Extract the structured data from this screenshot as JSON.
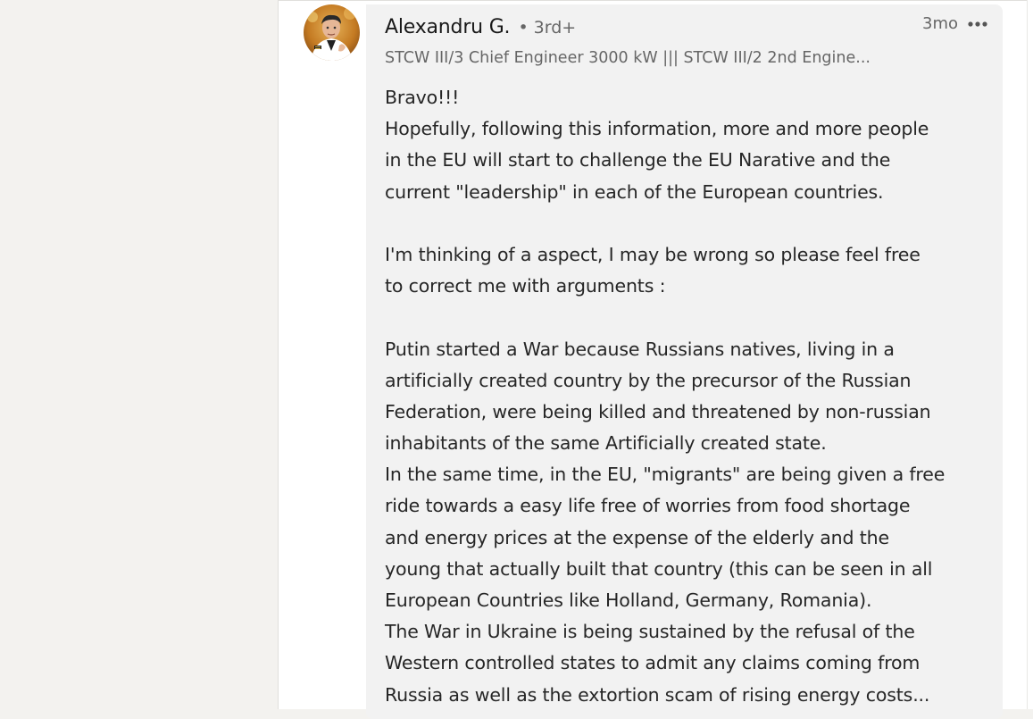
{
  "comment": {
    "author": {
      "name": "Alexandru G.",
      "degree": "• 3rd+",
      "headline": "STCW III/3 Chief Engineer 3000 kW ||| STCW III/2 2nd Engine..."
    },
    "timestamp": "3mo",
    "more_icon": "ellipsis-icon",
    "body": {
      "p1": [
        "Bravo!!!",
        "Hopefully, following this information, more and more people",
        "in the EU will start to challenge the EU Narative and the",
        "current \"leadership\" in each of the European countries."
      ],
      "p2": [
        "I'm thinking of a aspect, I may be wrong so please feel free",
        "to correct me with arguments :"
      ],
      "p3": [
        "Putin started a War because Russians natives, living in a",
        "artificially created country by the precursor of the Russian",
        "Federation, were being killed and threatened by non-russian",
        "inhabitants of the same Artificially created state.",
        "In the same time, in the EU, \"migrants\" are being given a free",
        "ride towards a easy life free of worries from food shortage",
        "and energy prices at the expense of the elderly and the",
        "young that actually built that country (this can be seen in all",
        "European Countries like Holland, Germany, Romania).",
        "The War in Ukraine is being sustained by the refusal of the",
        "Western controlled states to admit any claims coming from",
        "Russia as well as the extortion scam of rising energy costs..."
      ]
    }
  },
  "colors": {
    "page_background": "#f3f2ef",
    "card_background": "#ffffff",
    "bubble_background": "#f2f2f2",
    "text_primary": "#191919",
    "text_secondary": "#666666"
  }
}
